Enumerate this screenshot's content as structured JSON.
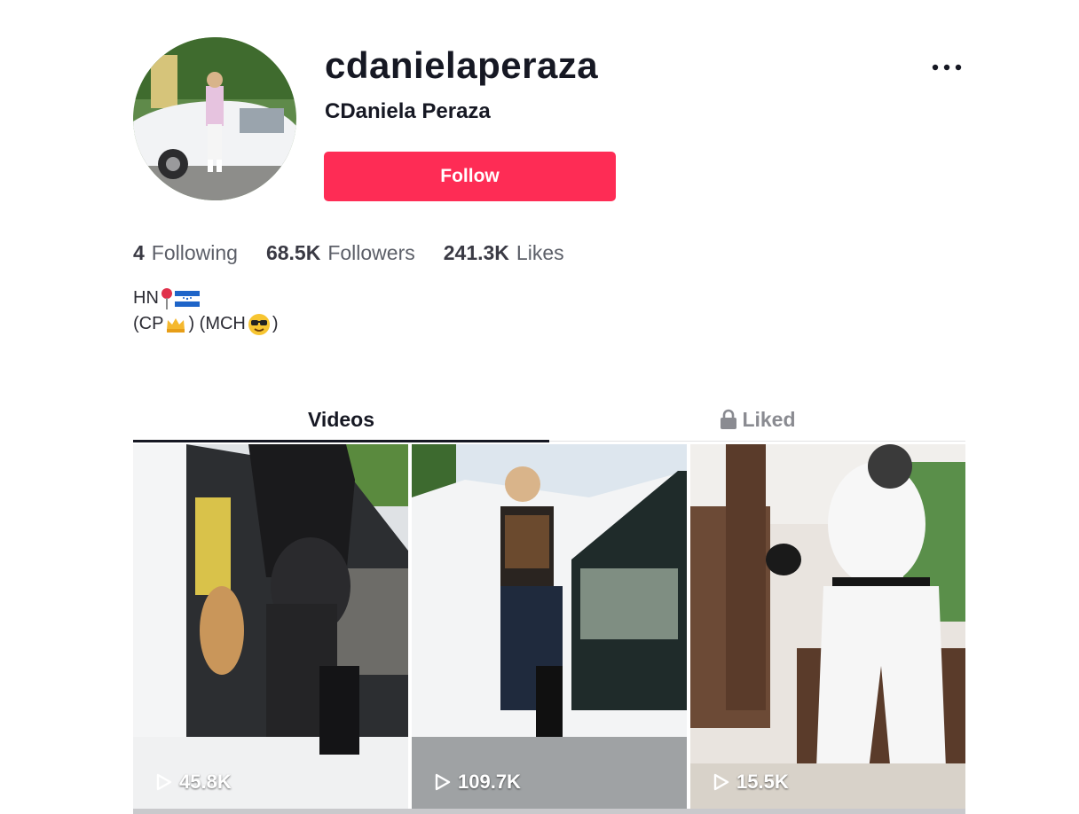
{
  "profile": {
    "username": "cdanielaperaza",
    "nickname": "CDaniela Peraza",
    "follow_label": "Follow",
    "more_icon": "ellipsis-icon"
  },
  "stats": {
    "following_count": "4",
    "following_label": "Following",
    "followers_count": "68.5K",
    "followers_label": "Followers",
    "likes_count": "241.3K",
    "likes_label": "Likes"
  },
  "bio": {
    "line1_text": "HN",
    "line1_icons": [
      "round-pushpin-icon",
      "honduras-flag-icon"
    ],
    "line2_prefix": "(CP",
    "line2_middle": ") (MCH",
    "line2_suffix": ")",
    "line2_icons": [
      "crown-icon",
      "sunglasses-face-icon"
    ]
  },
  "tabs": [
    {
      "label": "Videos",
      "active": true
    },
    {
      "label": "Liked",
      "active": false,
      "icon": "lock-icon"
    }
  ],
  "videos": [
    {
      "views": "45.8K"
    },
    {
      "views": "109.7K"
    },
    {
      "views": "15.5K"
    }
  ],
  "colors": {
    "follow_button": "#fe2c55",
    "text_primary": "#161823",
    "text_muted": "#8a8b91"
  }
}
